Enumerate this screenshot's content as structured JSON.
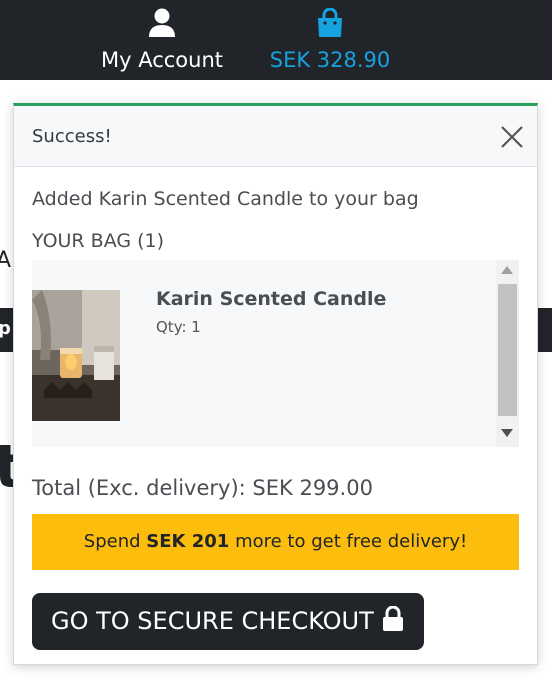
{
  "header": {
    "account_label": "My Account",
    "account_icon": "user-icon",
    "bag_total": "SEK 328.90",
    "bag_icon": "shopping-bag-icon",
    "accent_color": "#17a2e0",
    "background_color": "#212529"
  },
  "background_fragments": {
    "text_1": "Ab",
    "bar_text": "p",
    "text_2": "t"
  },
  "toast": {
    "title": "Success!",
    "close_icon": "close-icon",
    "message": "Added Karin Scented Candle to your bag",
    "bag_heading": "YOUR BAG (1)",
    "items": [
      {
        "name": "Karin Scented Candle",
        "qty": "Qty: 1",
        "image": "candle-product-image"
      }
    ],
    "total_label": "Total (Exc. delivery): SEK 299.00",
    "delivery_prefix": "Spend ",
    "delivery_amount": "SEK 201",
    "delivery_suffix": " more to get free delivery!",
    "delivery_color": "#fdbd0d",
    "checkout_label": "GO TO SECURE CHECKOUT",
    "checkout_icon": "lock-icon",
    "success_color": "#28a05a"
  }
}
